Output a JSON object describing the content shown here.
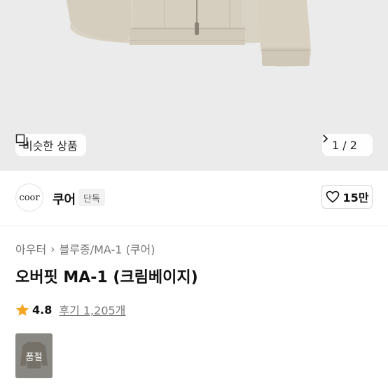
{
  "hero": {
    "image_name": "product-photo-jacket",
    "similar_label": "비슷한 상품",
    "pager_text": "1 / 2"
  },
  "brand": {
    "logo_text": "coor",
    "name": "쿠어",
    "badge": "단독",
    "like_count": "15만"
  },
  "product": {
    "breadcrumb": [
      "아우터",
      "블루종/MA-1 (쿠어)"
    ],
    "title": "오버핏 MA-1 (크림베이지)",
    "rating": "4.8",
    "reviews_label": "후기 1,205개",
    "thumbnail_status": "품절"
  },
  "colors": {
    "jacket": "#d8d2c4",
    "hero_bg": "#ebebeb",
    "star": "#f5a623"
  }
}
